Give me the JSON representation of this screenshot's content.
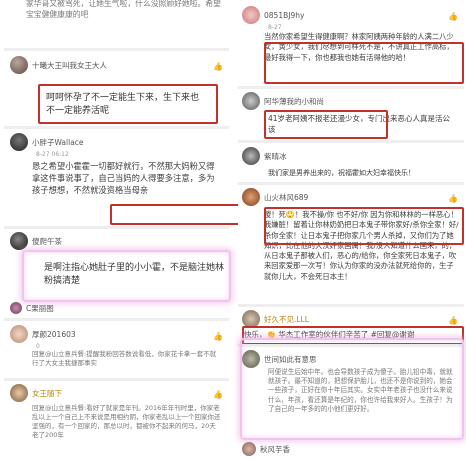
{
  "left": {
    "top_text": "家华哥又被骂死，让她生气啦，什么没照顾好她啦。希望宝宝健健康康的吧",
    "c1": {
      "name": "十曦大王叫我女王大人",
      "text": "呵呵怀孕了不一定能生下来，生下来也不一定能养活呢"
    },
    "c2": {
      "name": "小胖子Wallace",
      "time": "8-27 06:12",
      "text": "恳之希望小霍霍一切都好就行，不然那大妈粉又得拿这件事说事了，自己当妈的人得要多注意，多为孩子想想，不然就没资格当母亲",
      "box_text": "不然就没资格当母亲"
    },
    "c3": {
      "name": "傻爬午茶",
      "text": "是啊注指心她肚子里的小小霍，不是脑注她林粉搞清楚"
    },
    "c4_user": "C果丽图",
    "c5": {
      "name": "厚颜201603",
      "time": "0",
      "text": "回复@山立意兵餐:提醒我粉回答数说看低，你家花卡拿一套不就行了大女主我捷那事实"
    },
    "c6": {
      "name": "女王随下",
      "text": "回复@山立意兵餐:看好了就家是年刊。2016年年刊时里，你家老乱以上一个自己上不来说是用相约阴，你家老乱以上一个回家你还坚强的，有一个回家的，那总以时，都被你不起来的何马，20天老了200年"
    }
  },
  "right": {
    "c1": {
      "name": "0851BJ9hy",
      "time": "8-27",
      "text": "当然你家希望生得健康啊？林家阿姨两种年龄的人满二八少女，黄少女，我们尽想到可样死不是，不讲真正工作高标，最好我得一下，你也都我也她有活得他的哈！"
    },
    "c2": {
      "name": "阿华薄我的小和尚",
      "text": "41岁老阿姨不报老还漫少女，专门出来恶心人真是活公该"
    },
    "c3": {
      "name": "紫晴冰",
      "text": "我们家是男养出来的，祝福霍如大妇幸福快乐！"
    },
    "c4": {
      "name": "山火林风689",
      "text": "傻！死🙄！我不操/你 也不好/你 因为你和林林的一样恶心！我嫌脏！留着让你林奶奶把日本鬼子带你家好/杀你全家！好/杀你全家！让日本鬼子把你家几个男人杀掉，又你们为了她知识，比在他的大汉奸家国属！我/没人知道什么国来，的，从日本鬼子那被人们，恶心的/给你，你全家死日本鬼子，吹来回家爱那一次写！你认为你家的没办法就死给你的，生子就你儿大，不会死日本主！"
    },
    "c5": {
      "name": "好久不见.LLL",
      "text": "快乐，👏 华杰工作室的伙伴们辛苦了 #回复@谢谢"
    },
    "c6": {
      "name": "世间如此有意思",
      "text": "阿便说生后始中年。也会导数孩子成为傻子。胎儿铅中毒，就就就孩子。最不知道的，把想保护胎儿，也还不是你说到的，她会一些孩子，正好在你十年后其实。女实中年老孩子也没什么来说什么，年孩，看还算是年纪的，你也许给我来好人。生孩子！为了自己的一年多的的小他们更好好。"
    },
    "c7_user": "秋风芋香"
  },
  "colors": {
    "red_box": "#c2312c",
    "pink_glow": "#f0c5ec",
    "link": "#4d6fa8"
  }
}
